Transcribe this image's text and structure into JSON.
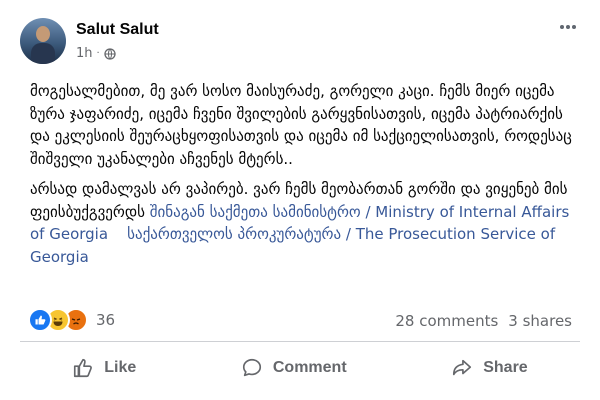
{
  "post": {
    "author": "Salut Salut",
    "time": "1h",
    "visibility_icon": "globe-icon",
    "paragraph1": "მოგესალმებით, მე ვარ სოსო მაისურაძე, გორელი კაცი. ჩემს მიერ იცემა ზურა ჯაფარიძე, იცემა ჩვენი შვილების გარყვნისათვის, იცემა პატრიარქის და ეკლესიის შეურაცხყოფისათვის და იცემა იმ საქციელისათვის, როდესაც შიშველი უკანალები აჩვენეს მტერს..",
    "paragraph2_text": "არსად დამალვას არ ვაპირებ. ვარ ჩემს მეობართან გორში და ვიყენებ მის ფეისბუქგვერდს ",
    "link1": "შინაგან საქმეთა სამინისტრო / Ministry of Internal Affairs of Georgia",
    "link2": "საქართველოს პროკურატურა / The Prosecution Service of Georgia"
  },
  "reactions": {
    "icons": [
      "like-icon",
      "haha-icon",
      "angry-icon"
    ],
    "count": "36",
    "colors": {
      "like": "#1877f2",
      "haha": "#f7c531",
      "angry": "#e9710f"
    }
  },
  "stats": {
    "comments": "28 comments",
    "shares": "3 shares"
  },
  "actions": {
    "like": "Like",
    "comment": "Comment",
    "share": "Share"
  },
  "colors": {
    "link": "#385898",
    "secondary_text": "#65676b",
    "primary_text": "#050505"
  }
}
